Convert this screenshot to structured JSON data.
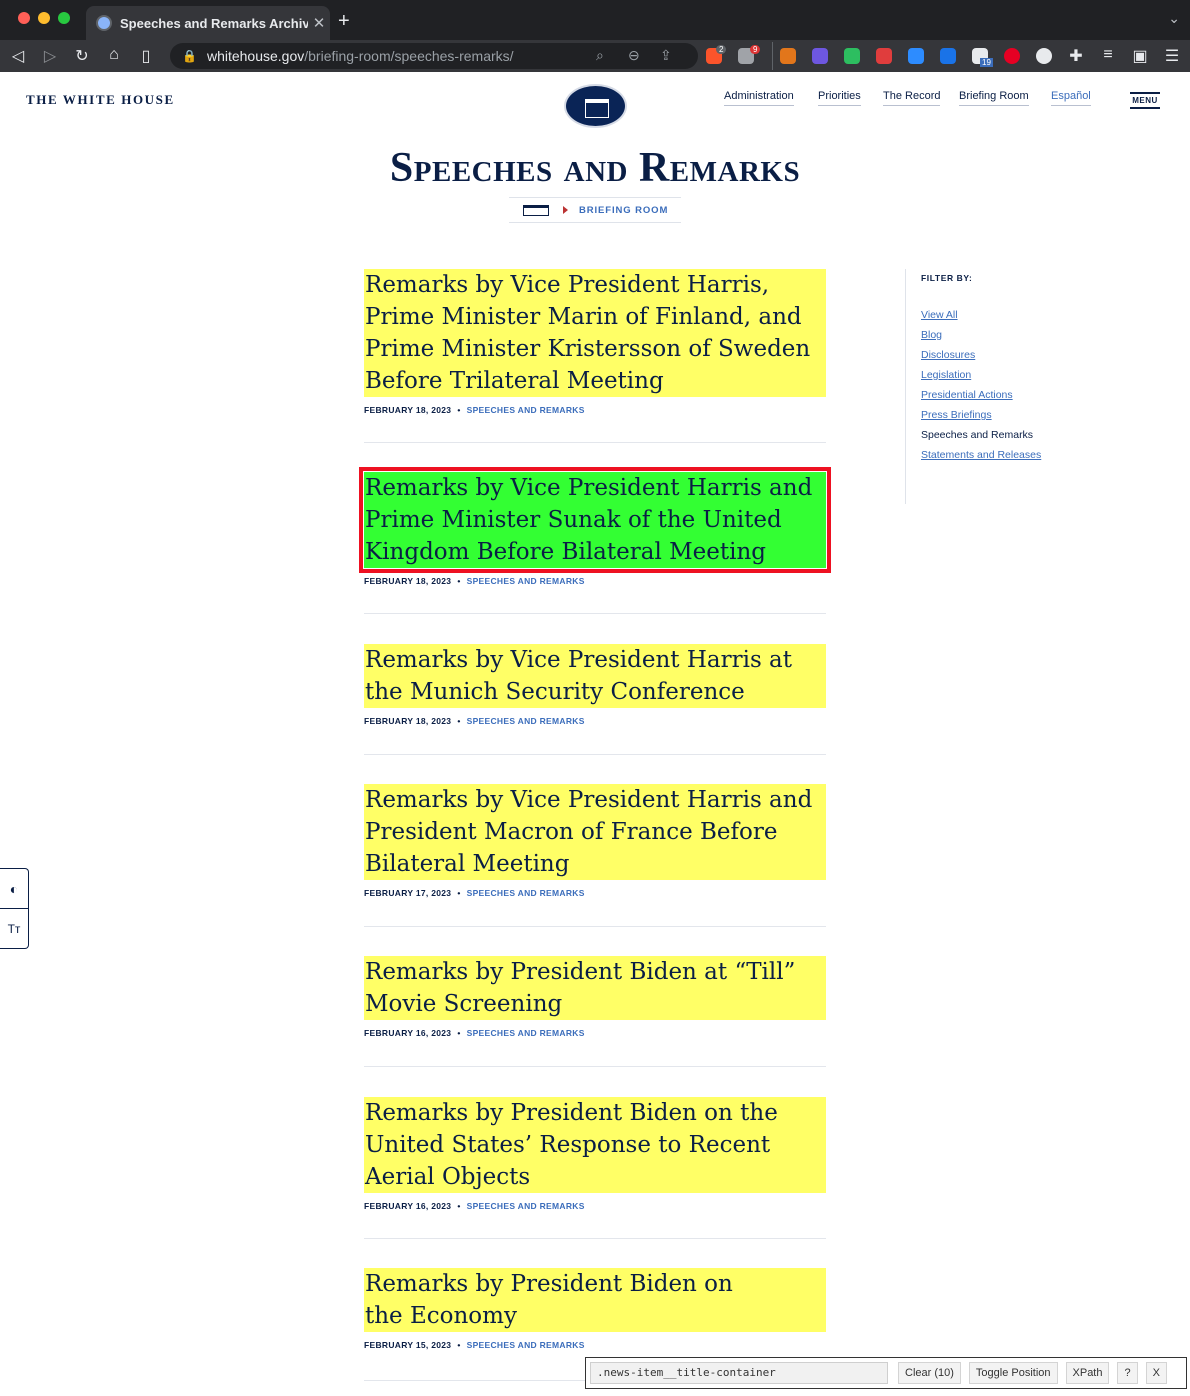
{
  "browser": {
    "tab_title": "Speeches and Remarks Archives",
    "url_host": "whitehouse.gov",
    "url_path": "/briefing-room/speeches-remarks/",
    "ext_badge_1": "2",
    "ext_badge_2": "9",
    "ext_badge_3": "19"
  },
  "site": {
    "brand": "THE WHITE HOUSE",
    "nav": [
      "Administration",
      "Priorities",
      "The Record",
      "Briefing Room",
      "Español"
    ],
    "menu_label": "MENU",
    "page_title": "Speeches and Remarks",
    "breadcrumb": "BRIEFING ROOM"
  },
  "filter": {
    "heading": "FILTER BY:",
    "items": [
      "View All",
      "Blog",
      "Disclosures",
      "Legislation",
      "Presidential Actions",
      "Press Briefings",
      "Speeches and Remarks",
      "Statements and Releases"
    ],
    "current": "Speeches and Remarks"
  },
  "news": [
    {
      "title": "Remarks by Vice President Harris, Prime Minister Marin of Finland, and Prime Minister Kristersson of Sweden Before Trilateral Meeting",
      "date": "FEBRUARY 18, 2023",
      "category": "SPEECHES AND REMARKS"
    },
    {
      "title": "Remarks by Vice President Harris and Prime Minister Sunak of the United Kingdom Before Bilateral Meeting",
      "date": "FEBRUARY 18, 2023",
      "category": "SPEECHES AND REMARKS",
      "selected": true
    },
    {
      "title": "Remarks by Vice President Harris at the Munich Security Conference",
      "date": "FEBRUARY 18, 2023",
      "category": "SPEECHES AND REMARKS"
    },
    {
      "title": "Remarks by Vice President Harris and President Macron of France Before Bilateral Meeting",
      "date": "FEBRUARY 17, 2023",
      "category": "SPEECHES AND REMARKS"
    },
    {
      "title": "Remarks by President Biden at “Till” Movie Screening",
      "date": "FEBRUARY 16, 2023",
      "category": "SPEECHES AND REMARKS"
    },
    {
      "title": "Remarks by President Biden on the United States’ Response to Recent Aerial Objects",
      "date": "FEBRUARY 16, 2023",
      "category": "SPEECHES AND REMARKS"
    },
    {
      "title": "Remarks by President Biden on the Economy",
      "date": "FEBRUARY 15, 2023",
      "category": "SPEECHES AND REMARKS"
    }
  ],
  "selector_tool": {
    "query": ".news-item__title-container",
    "clear_label": "Clear (10)",
    "toggle_label": "Toggle Position",
    "xpath_label": "XPath",
    "help_label": "?",
    "close_label": "X"
  }
}
